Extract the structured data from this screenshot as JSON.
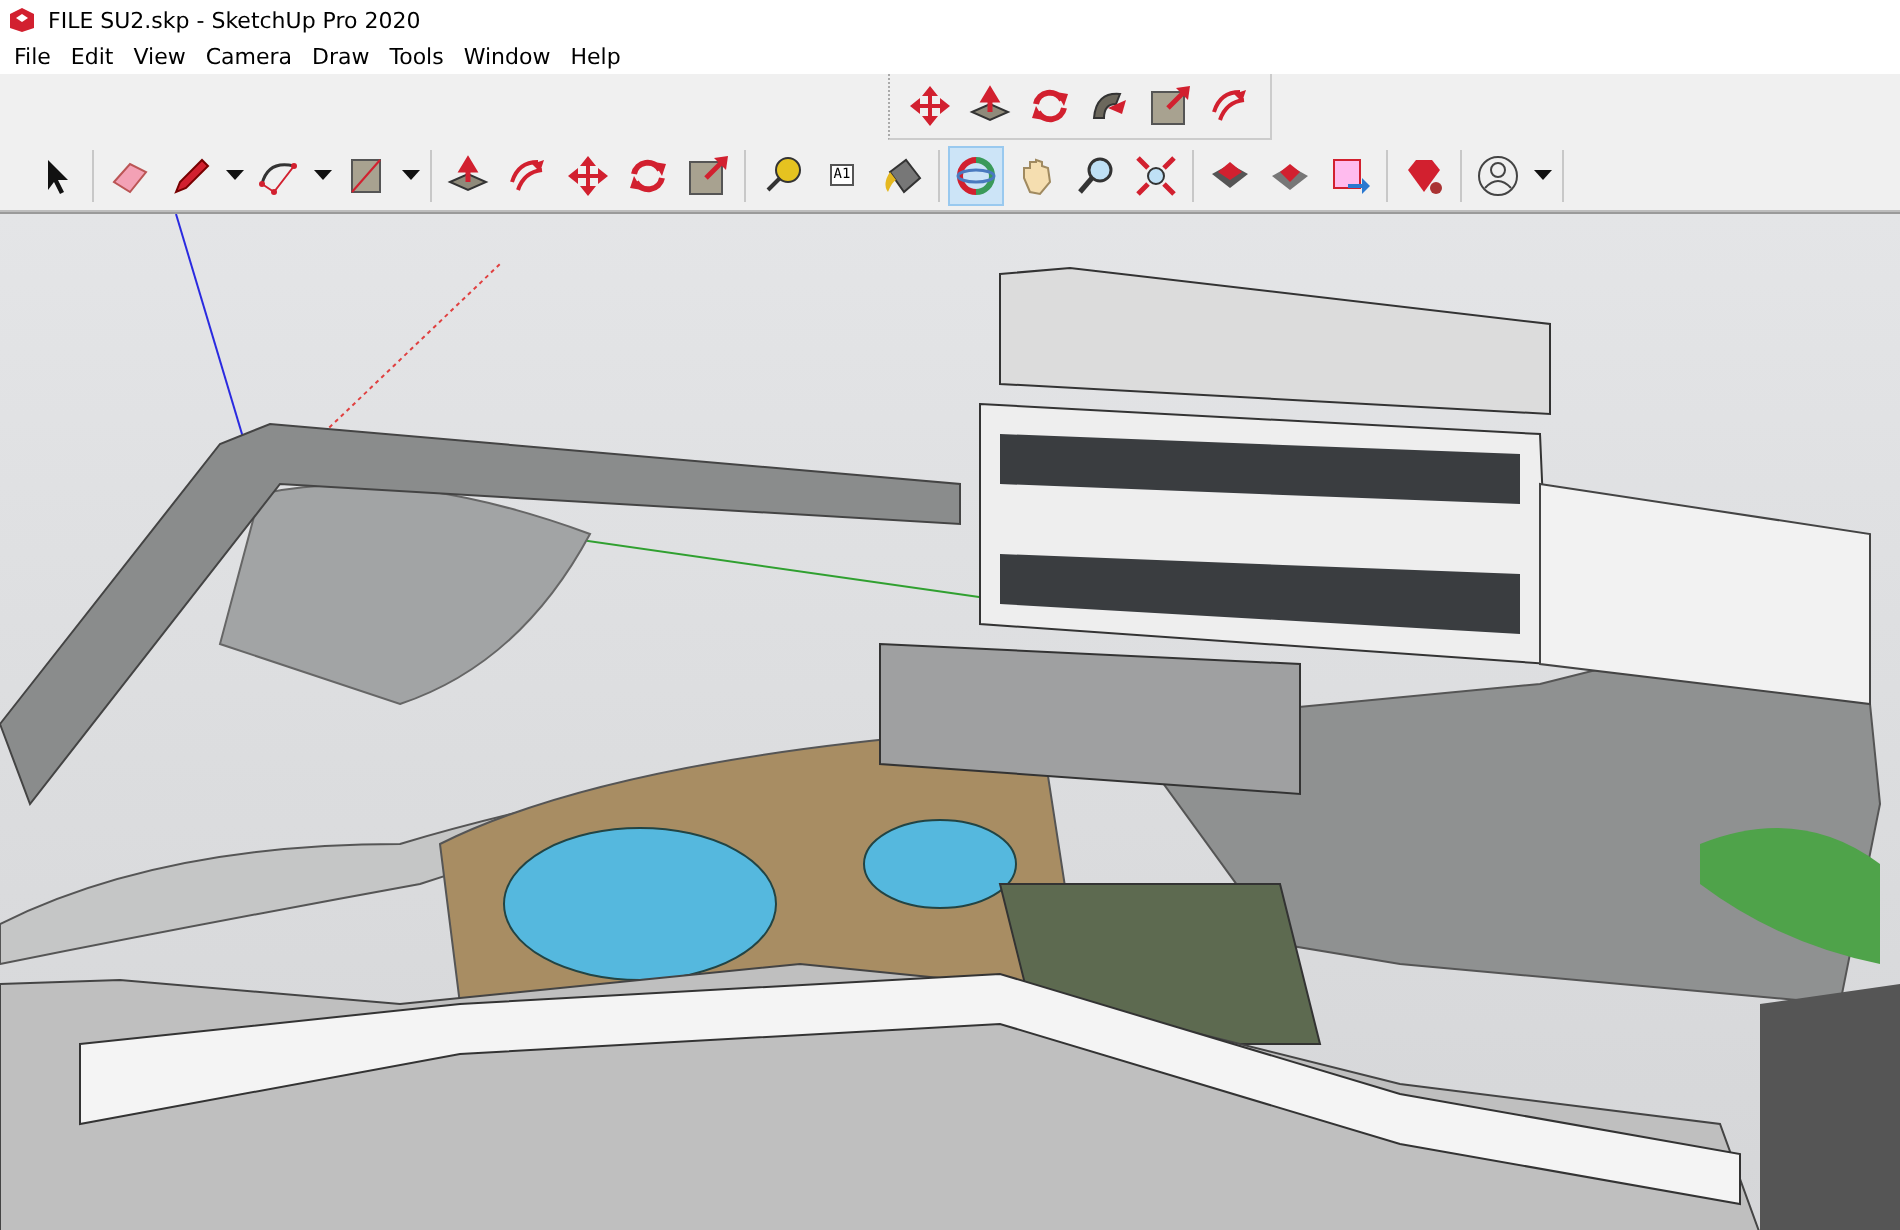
{
  "window": {
    "title": "FILE SU2.skp - SketchUp Pro 2020"
  },
  "menu": [
    "File",
    "Edit",
    "View",
    "Camera",
    "Draw",
    "Tools",
    "Window",
    "Help"
  ],
  "edit_toolbar": [
    {
      "kind": "move",
      "selected": false
    },
    {
      "kind": "pushpull",
      "selected": false
    },
    {
      "kind": "rotate",
      "selected": false
    },
    {
      "kind": "followme",
      "selected": false
    },
    {
      "kind": "scale",
      "selected": false
    },
    {
      "kind": "offset",
      "selected": false
    }
  ],
  "main_toolbar": [
    [
      {
        "kind": "select",
        "selected": false
      }
    ],
    [
      {
        "kind": "eraser",
        "selected": false
      },
      {
        "kind": "pencil",
        "selected": false
      },
      {
        "kind": "dropdown",
        "selected": false
      },
      {
        "kind": "arc",
        "selected": false
      },
      {
        "kind": "dropdown",
        "selected": false
      },
      {
        "kind": "rectangle",
        "selected": false
      },
      {
        "kind": "dropdown",
        "selected": false
      }
    ],
    [
      {
        "kind": "pushpull",
        "selected": false
      },
      {
        "kind": "offset",
        "selected": false
      },
      {
        "kind": "move",
        "selected": false
      },
      {
        "kind": "rotate",
        "selected": false
      },
      {
        "kind": "scale",
        "selected": false
      }
    ],
    [
      {
        "kind": "tape",
        "selected": false
      },
      {
        "kind": "text",
        "selected": false
      },
      {
        "kind": "paint",
        "selected": false
      }
    ],
    [
      {
        "kind": "orbit",
        "selected": true
      },
      {
        "kind": "pan",
        "selected": false
      },
      {
        "kind": "zoom",
        "selected": false
      },
      {
        "kind": "extents",
        "selected": false
      }
    ],
    [
      {
        "kind": "warehouse",
        "selected": false
      },
      {
        "kind": "extensions",
        "selected": false
      },
      {
        "kind": "layout",
        "selected": false
      }
    ],
    [
      {
        "kind": "ruby",
        "selected": false
      }
    ],
    [
      {
        "kind": "profile",
        "selected": false
      },
      {
        "kind": "dropdown",
        "selected": false
      }
    ]
  ],
  "text_tool_label": "A1"
}
